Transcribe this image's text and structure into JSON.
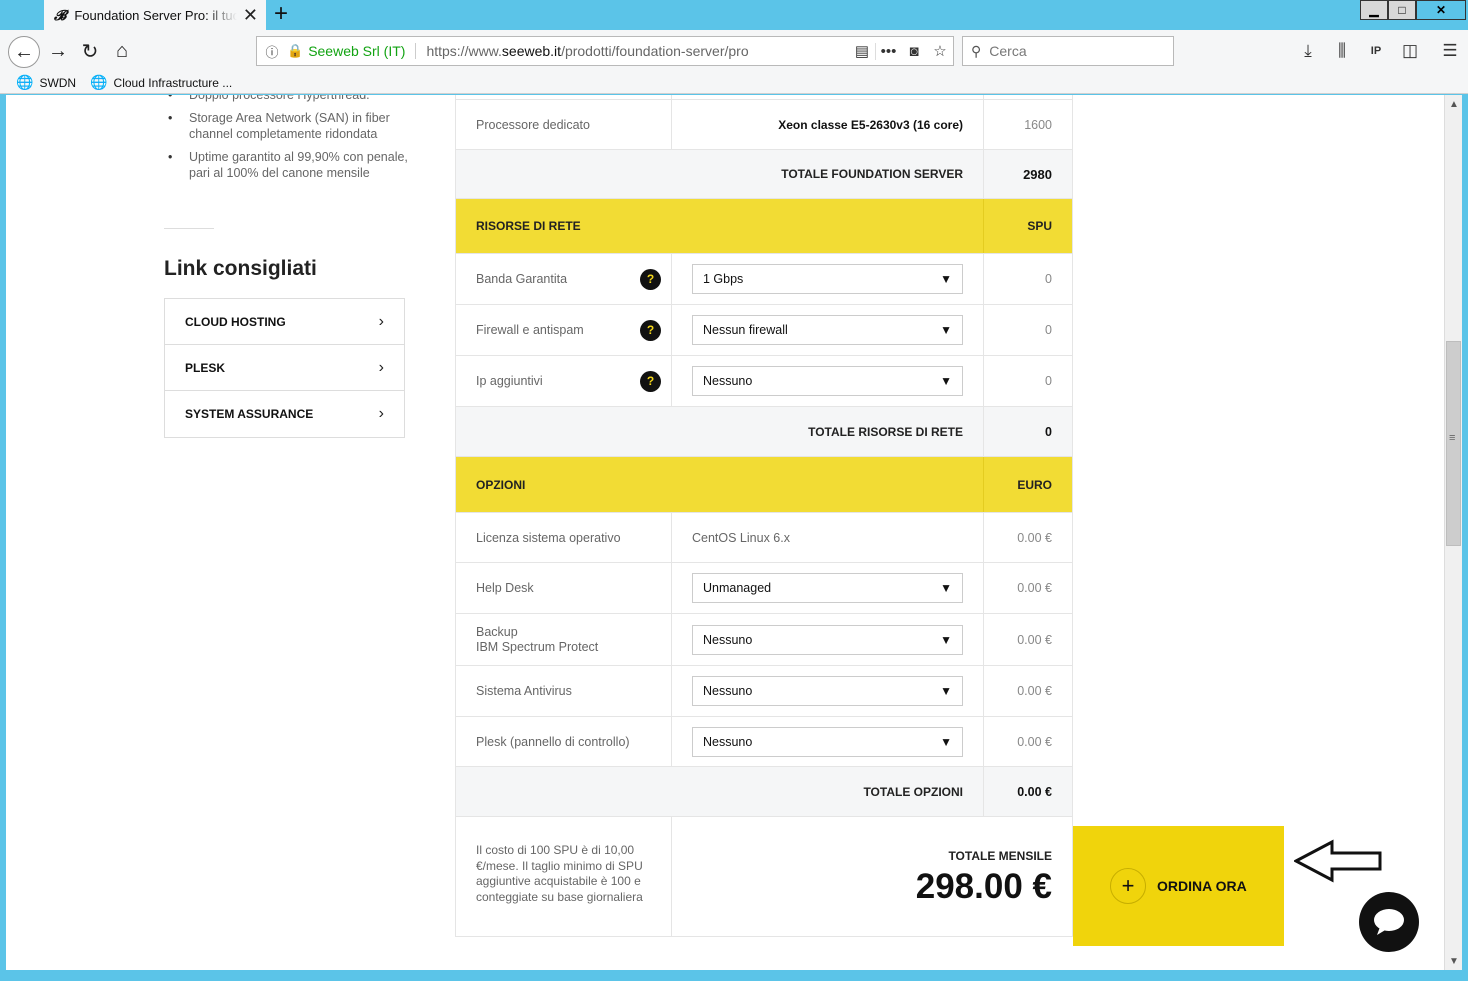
{
  "browser": {
    "tab_title": "Foundation Server Pro: il tuo se",
    "url_org": "Seeweb Srl (IT)",
    "url_prefix": "https://www.",
    "url_domain": "seeweb.it",
    "url_path": "/prodotti/foundation-server/pro",
    "search_placeholder": "Cerca",
    "bookmarks": [
      "SWDN",
      "Cloud Infrastructure ..."
    ]
  },
  "sidebar": {
    "features": [
      "Doppio processore Hyperthread.",
      "Storage Area Network (SAN) in fiber channel completamente ridondata",
      "Uptime garantito al 99,90% con penale, pari al 100% del canone mensile"
    ],
    "links_title": "Link consigliati",
    "links": [
      "CLOUD HOSTING",
      "PLESK",
      "SYSTEM ASSURANCE"
    ]
  },
  "table": {
    "processor_label": "Processore dedicato",
    "processor_value": "Xeon classe E5-2630v3 (16 core)",
    "processor_spu": "1600",
    "total_server_label": "TOTALE FOUNDATION SERVER",
    "total_server_value": "2980",
    "network_header": "RISORSE DI RETE",
    "network_unit": "SPU",
    "network_rows": [
      {
        "label": "Banda Garantita",
        "value": "1 Gbps",
        "spu": "0"
      },
      {
        "label": "Firewall e antispam",
        "value": "Nessun firewall",
        "spu": "0"
      },
      {
        "label": "Ip aggiuntivi",
        "value": "Nessuno",
        "spu": "0"
      }
    ],
    "help_icon": "?",
    "total_network_label": "TOTALE RISORSE DI RETE",
    "total_network_value": "0",
    "options_header": "OPZIONI",
    "options_unit": "EURO",
    "license_label": "Licenza sistema operativo",
    "license_value": "CentOS Linux 6.x",
    "license_price": "0.00 €",
    "helpdesk_label": "Help Desk",
    "helpdesk_value": "Unmanaged",
    "helpdesk_price": "0.00 €",
    "backup_label_1": "Backup",
    "backup_label_2": "IBM Spectrum Protect",
    "backup_value": "Nessuno",
    "backup_price": "0.00 €",
    "antivirus_label": "Sistema Antivirus",
    "antivirus_value": "Nessuno",
    "antivirus_price": "0.00 €",
    "plesk_label": "Plesk (pannello di controllo)",
    "plesk_value": "Nessuno",
    "plesk_price": "0.00 €",
    "total_options_label": "TOTALE OPZIONI",
    "total_options_value": "0.00 €",
    "note": "Il costo di 100 SPU è di 10,00 €/mese. Il taglio minimo di SPU aggiuntive acquistabile è 100 e conteggiate su base giornaliera",
    "monthly_label": "TOTALE MENSILE",
    "monthly_value": "298.00 €"
  },
  "order": {
    "label": "ORDINA ORA",
    "plus": "+"
  },
  "colors": {
    "accent_yellow": "#f2dc34",
    "order_yellow": "#f0d40c",
    "secure_green": "#12a312",
    "titlebar_blue": "#5bc4e8"
  }
}
